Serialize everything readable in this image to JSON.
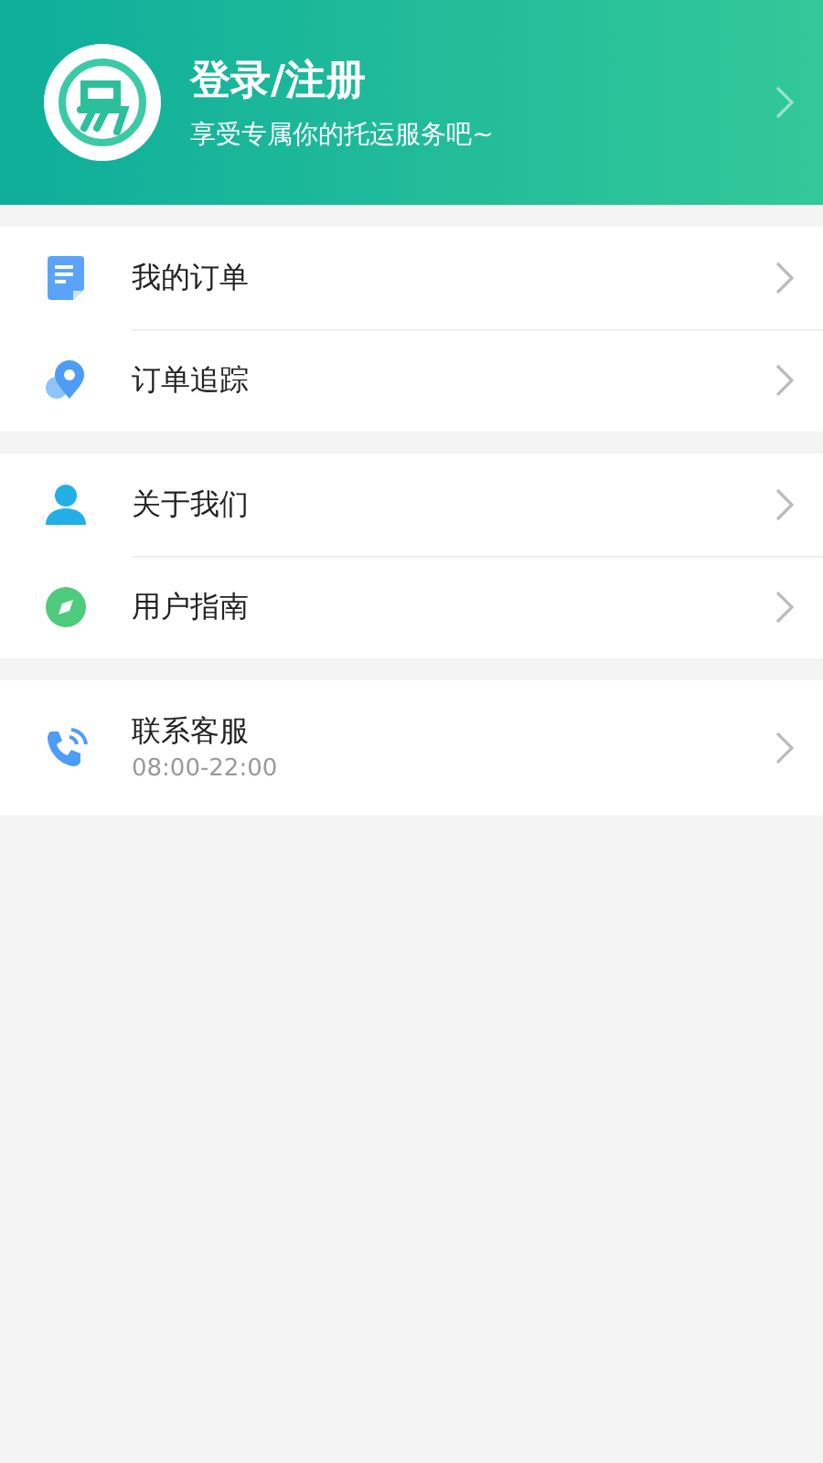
{
  "header": {
    "title": "登录/注册",
    "subtitle": "享受专属你的托运服务吧~"
  },
  "groups": [
    {
      "items": [
        {
          "kind": "document",
          "title": "我的订单"
        },
        {
          "kind": "pin",
          "title": "订单追踪"
        }
      ]
    },
    {
      "items": [
        {
          "kind": "person",
          "title": "关于我们"
        },
        {
          "kind": "compass",
          "title": "用户指南"
        }
      ]
    },
    {
      "items": [
        {
          "kind": "phone",
          "title": "联系客服",
          "subtitle": "08:00-22:00"
        }
      ]
    }
  ]
}
